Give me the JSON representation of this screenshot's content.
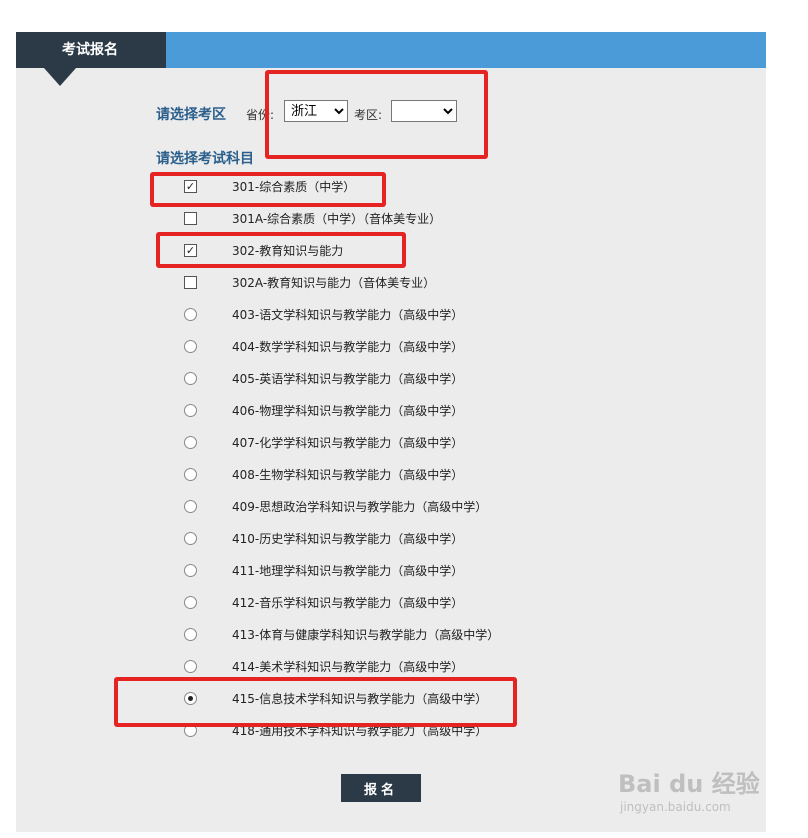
{
  "tab_title": "考试报名",
  "region": {
    "label": "请选择考区",
    "province_label": "省份:",
    "province_value": "浙江",
    "district_label": "考区:",
    "district_value": ""
  },
  "subjects_label": "请选择考试科目",
  "subjects": [
    {
      "label": "301-综合素质（中学）",
      "type": "checkbox",
      "checked": true
    },
    {
      "label": "301A-综合素质（中学）（音体美专业）",
      "type": "checkbox",
      "checked": false
    },
    {
      "label": "302-教育知识与能力",
      "type": "checkbox",
      "checked": true
    },
    {
      "label": "302A-教育知识与能力（音体美专业）",
      "type": "checkbox",
      "checked": false
    },
    {
      "label": "403-语文学科知识与教学能力（高级中学）",
      "type": "radio",
      "checked": false
    },
    {
      "label": "404-数学学科知识与教学能力（高级中学）",
      "type": "radio",
      "checked": false
    },
    {
      "label": "405-英语学科知识与教学能力（高级中学）",
      "type": "radio",
      "checked": false
    },
    {
      "label": "406-物理学科知识与教学能力（高级中学）",
      "type": "radio",
      "checked": false
    },
    {
      "label": "407-化学学科知识与教学能力（高级中学）",
      "type": "radio",
      "checked": false
    },
    {
      "label": "408-生物学科知识与教学能力（高级中学）",
      "type": "radio",
      "checked": false
    },
    {
      "label": "409-思想政治学科知识与教学能力（高级中学）",
      "type": "radio",
      "checked": false
    },
    {
      "label": "410-历史学科知识与教学能力（高级中学）",
      "type": "radio",
      "checked": false
    },
    {
      "label": "411-地理学科知识与教学能力（高级中学）",
      "type": "radio",
      "checked": false
    },
    {
      "label": "412-音乐学科知识与教学能力（高级中学）",
      "type": "radio",
      "checked": false
    },
    {
      "label": "413-体育与健康学科知识与教学能力（高级中学）",
      "type": "radio",
      "checked": false
    },
    {
      "label": "414-美术学科知识与教学能力（高级中学）",
      "type": "radio",
      "checked": false
    },
    {
      "label": "415-信息技术学科知识与教学能力（高级中学）",
      "type": "radio",
      "checked": true
    },
    {
      "label": "418-通用技术学科知识与教学能力（高级中学）",
      "type": "radio",
      "checked": false
    }
  ],
  "submit_label": "报名",
  "watermark": {
    "brand": "Bai du 经验",
    "url": "jingyan.baidu.com"
  },
  "colors": {
    "accent": "#4b9bd9",
    "tab": "#2c3a48",
    "highlight": "#e62323"
  }
}
